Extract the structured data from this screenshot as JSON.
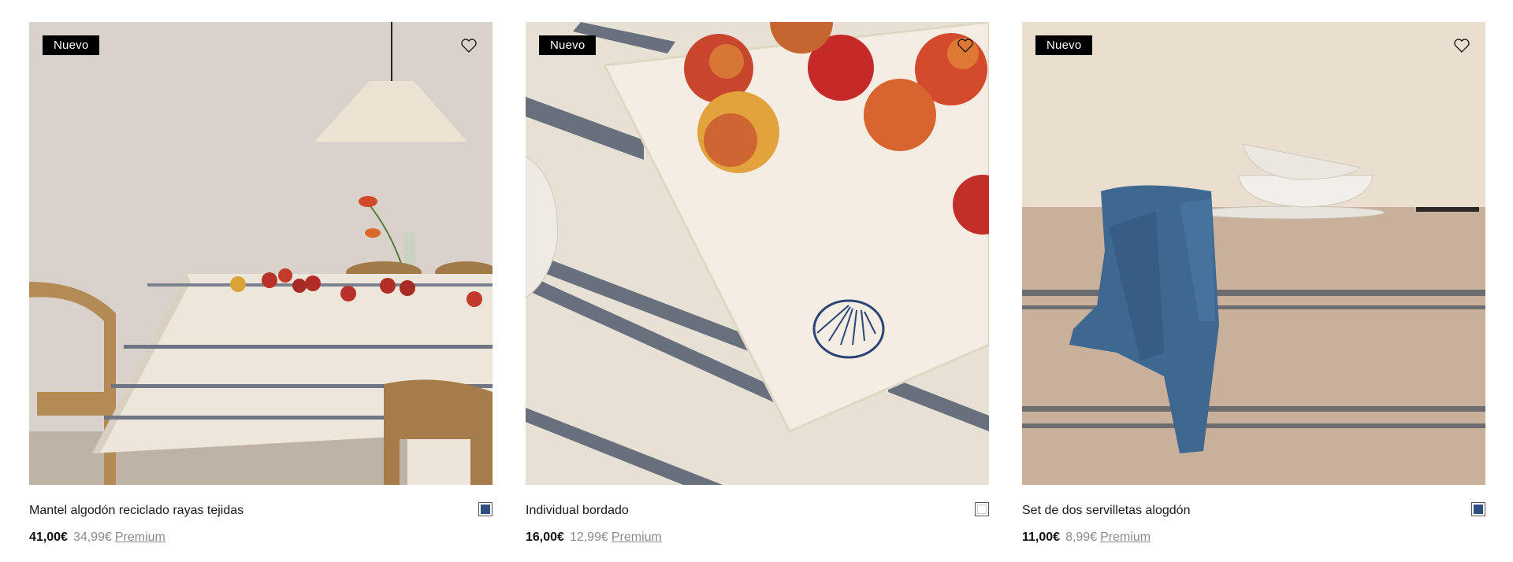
{
  "products": [
    {
      "badge": "Nuevo",
      "name": "Mantel algodón reciclado rayas tejidas",
      "price": "41,00€",
      "premium_price": "34,99€",
      "premium_label": "Premium",
      "swatch_color": "#2f4f80",
      "image_subject": "dining table with striped tablecloth, apples, pendant lamp and rattan chairs"
    },
    {
      "badge": "Nuevo",
      "name": "Individual bordado",
      "price": "16,00€",
      "premium_price": "12,99€",
      "premium_label": "Premium",
      "swatch_color": "#ffffff",
      "image_subject": "embroidered placemat with shell motif and apples on striped cloth"
    },
    {
      "badge": "Nuevo",
      "name": "Set de dos servilletas alogdón",
      "price": "11,00€",
      "premium_price": "8,99€",
      "premium_label": "Premium",
      "swatch_color": "#2f4f80",
      "image_subject": "blue cotton napkin hanging over striped tablecloth with white bowls"
    }
  ],
  "icons": {
    "favorite": "heart-outline-icon"
  }
}
